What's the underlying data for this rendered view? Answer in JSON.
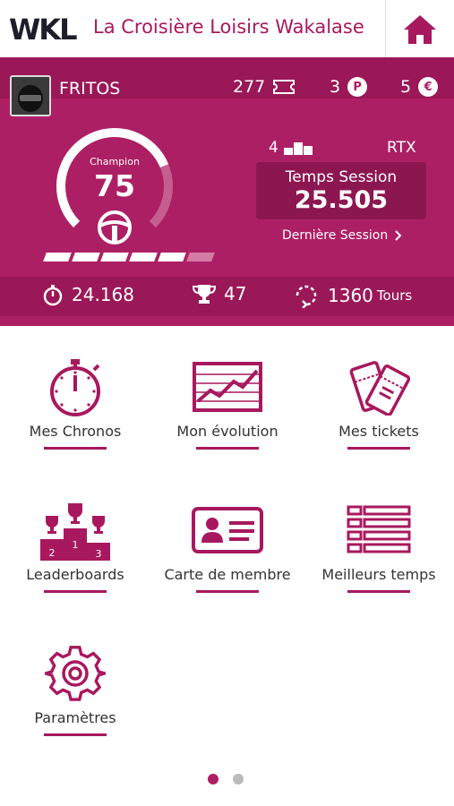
{
  "header": {
    "logo": "WKL",
    "title": "La Croisière Loisirs Wakalase",
    "home_icon": "home-icon"
  },
  "profile": {
    "username": "FRITOS",
    "tickets": "277",
    "points": "3",
    "credits": "5",
    "points_symbol": "P",
    "credits_symbol": "€"
  },
  "gauge": {
    "label": "Champion",
    "value": "75",
    "level_fraction": 0.75,
    "progress_segments_filled": 5,
    "progress_segments_total": 6
  },
  "session": {
    "rank": "4",
    "category": "RTX",
    "label": "Temps Session",
    "value": "25.505",
    "last_session_link": "Dernière Session"
  },
  "stats": {
    "best_time": "24.168",
    "trophies": "47",
    "laps": "1360",
    "laps_unit": "Tours"
  },
  "menu": [
    {
      "label": "Mes Chronos",
      "icon": "stopwatch-icon"
    },
    {
      "label": "Mon évolution",
      "icon": "chart-icon"
    },
    {
      "label": "Mes tickets",
      "icon": "tickets-icon"
    },
    {
      "label": "Leaderboards",
      "icon": "podium-icon"
    },
    {
      "label": "Carte de membre",
      "icon": "member-card-icon"
    },
    {
      "label": "Meilleurs temps",
      "icon": "list-icon"
    },
    {
      "label": "Paramètres",
      "icon": "gear-icon"
    }
  ],
  "pagination": {
    "pages": 2,
    "current": 1
  },
  "colors": {
    "brand": "#ad1f64",
    "brand_dark": "#9a1857",
    "text": "#333333"
  }
}
